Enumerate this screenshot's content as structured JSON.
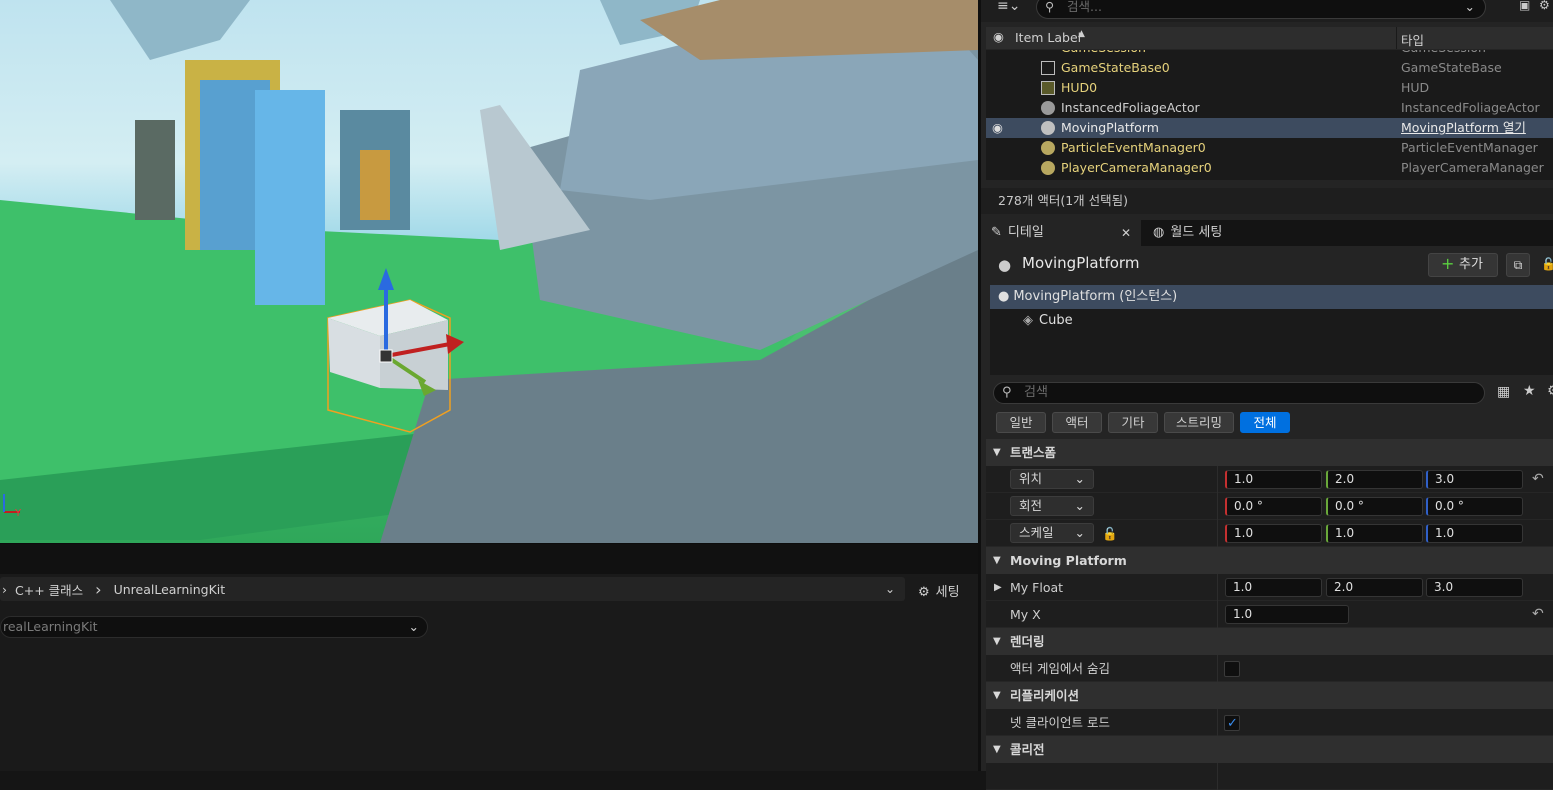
{
  "viewport": {
    "description_none": ""
  },
  "content_browser": {
    "breadcrumb_root": "C++ 클래스",
    "breadcrumb_child": "UnrealLearningKit",
    "settings_label": "세팅",
    "combo_text": "realLearningKit"
  },
  "outliner": {
    "search_placeholder": "검색...",
    "col_label": "Item Label",
    "col_type": "타입",
    "rows": [
      {
        "name": "GameSession",
        "type": "GameSession"
      },
      {
        "name": "GameStateBase0",
        "type": "GameStateBase"
      },
      {
        "name": "HUD0",
        "type": "HUD"
      },
      {
        "name": "InstancedFoliageActor",
        "type": "InstancedFoliageActor"
      },
      {
        "name": "MovingPlatform",
        "type": "MovingPlatform 열기"
      },
      {
        "name": "ParticleEventManager0",
        "type": "ParticleEventManager"
      },
      {
        "name": "PlayerCameraManager0",
        "type": "PlayerCameraManager"
      }
    ],
    "actor_count": "278개 액터(1개 선택됨)"
  },
  "tabs": {
    "details": "디테일",
    "world_settings": "월드 세팅"
  },
  "details": {
    "actor_name": "MovingPlatform",
    "add_label": "추가",
    "instance_label": "MovingPlatform (인스턴스)",
    "component_cube": "Cube",
    "search_placeholder": "검색",
    "filters": [
      "일반",
      "액터",
      "기타",
      "스트리밍",
      "전체"
    ],
    "transform": {
      "section": "트랜스폼",
      "location_label": "위치",
      "location": [
        "1.0",
        "2.0",
        "3.0"
      ],
      "rotation_label": "회전",
      "rotation": [
        "0.0 °",
        "0.0 °",
        "0.0 °"
      ],
      "scale_label": "스케일",
      "scale": [
        "1.0",
        "1.0",
        "1.0"
      ]
    },
    "moving_platform": {
      "section": "Moving Platform",
      "my_float_label": "My Float",
      "my_float": [
        "1.0",
        "2.0",
        "3.0"
      ],
      "my_x_label": "My X",
      "my_x": "1.0"
    },
    "rendering": {
      "section": "렌더링",
      "hide_in_game_label": "액터 게임에서 숨김",
      "hide_in_game": false
    },
    "replication": {
      "section": "리플리케이션",
      "net_load_label": "넷 클라이언트 로드",
      "net_load": true
    },
    "collision": {
      "section": "콜리전"
    }
  },
  "colors": {
    "accent": "#0070e0",
    "actor_name": "#e6d27c",
    "selection": "#3d4b5f"
  }
}
